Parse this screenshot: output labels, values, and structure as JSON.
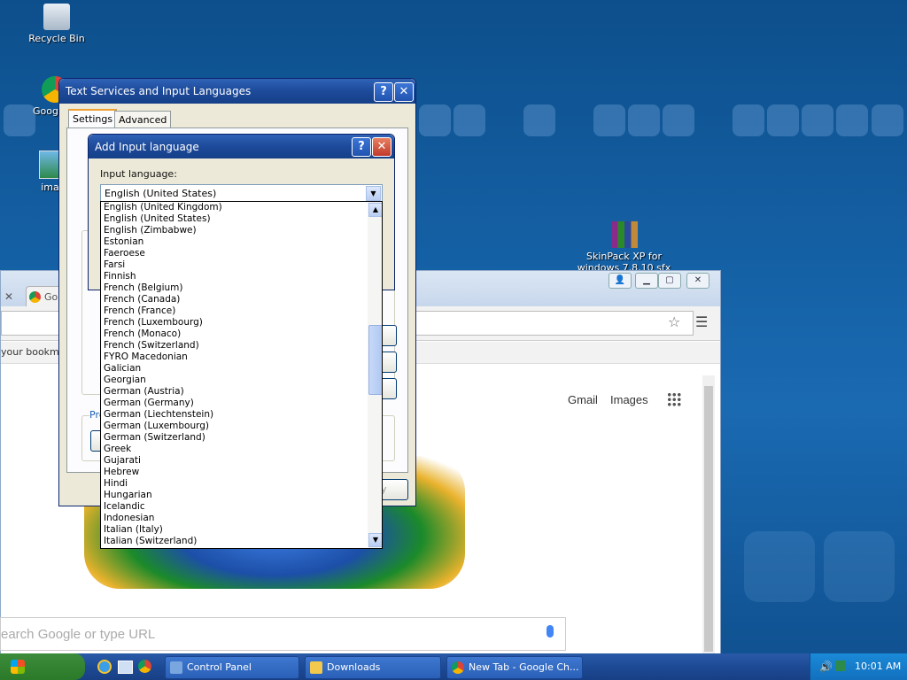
{
  "desktop": {
    "icons": [
      {
        "label": "Recycle Bin"
      },
      {
        "label": "Google C"
      },
      {
        "label": "imag"
      },
      {
        "label": "SkinPack XP for windows 7,8,10 sfx"
      }
    ]
  },
  "chrome": {
    "tab_label": "Go",
    "bookmarks_text": "your bookmark",
    "header_links": {
      "gmail": "Gmail",
      "images": "Images"
    },
    "search_placeholder": "earch Google or type URL",
    "partial_label": "Pre"
  },
  "text_services_dialog": {
    "title": "Text Services and Input Languages",
    "tabs": [
      "Settings",
      "Advanced"
    ],
    "apply_partial": "y"
  },
  "add_language_dialog": {
    "title": "Add Input language",
    "input_language_label": "Input language:",
    "selected_value": "English (United States)",
    "options": [
      "English (United Kingdom)",
      "English (United States)",
      "English (Zimbabwe)",
      "Estonian",
      "Faeroese",
      "Farsi",
      "Finnish",
      "French (Belgium)",
      "French (Canada)",
      "French (France)",
      "French (Luxembourg)",
      "French (Monaco)",
      "French (Switzerland)",
      "FYRO Macedonian",
      "Galician",
      "Georgian",
      "German (Austria)",
      "German (Germany)",
      "German (Liechtenstein)",
      "German (Luxembourg)",
      "German (Switzerland)",
      "Greek",
      "Gujarati",
      "Hebrew",
      "Hindi",
      "Hungarian",
      "Icelandic",
      "Indonesian",
      "Italian (Italy)",
      "Italian (Switzerland)"
    ]
  },
  "taskbar": {
    "items": [
      "Control Panel",
      "Downloads",
      "New Tab - Google Ch..."
    ],
    "clock": "10:01 AM"
  },
  "colors": {
    "xp_title": "#1d4a9a",
    "desktop": "#1561a6"
  }
}
